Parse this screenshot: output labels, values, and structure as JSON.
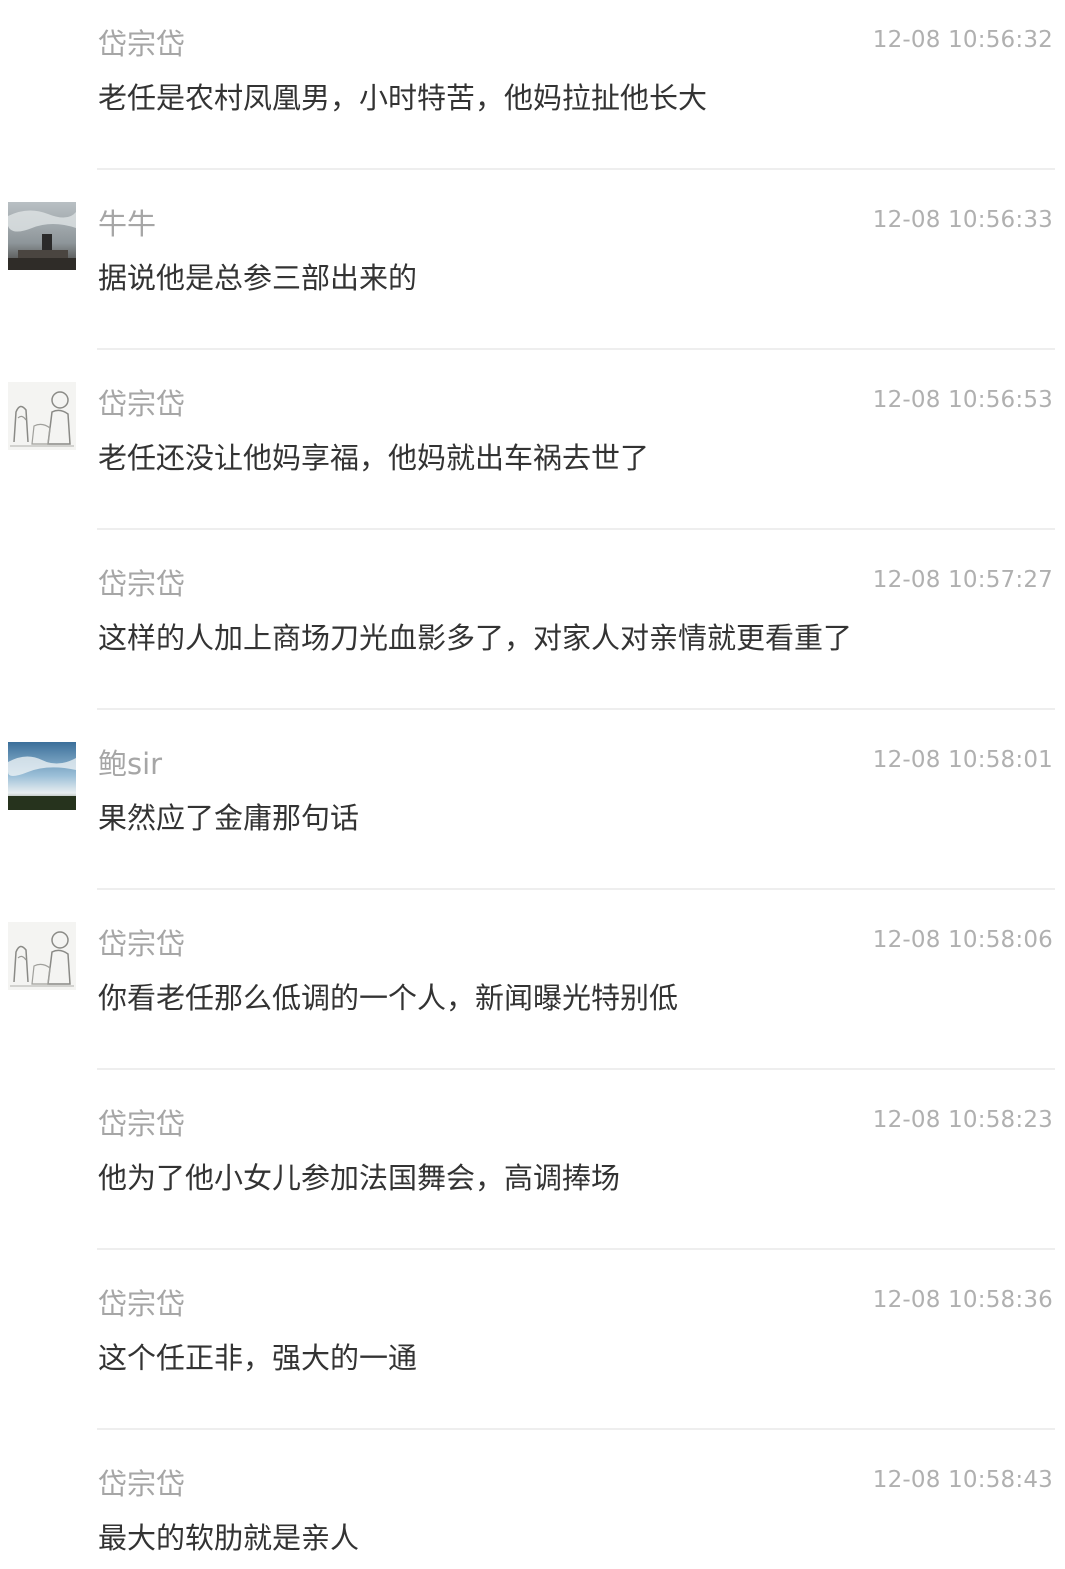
{
  "comments": [
    {
      "author": "岱宗岱",
      "time": "12-08 10:56:32",
      "text": "老任是农村凤凰男，小时特苦，他妈拉扯他长大",
      "avatar": "none"
    },
    {
      "author": "牛牛",
      "time": "12-08 10:56:33",
      "text": "据说他是总参三部出来的",
      "avatar": "photo-avatar"
    },
    {
      "author": "岱宗岱",
      "time": "12-08 10:56:53",
      "text": "老任还没让他妈享福，他妈就出车祸去世了",
      "avatar": "sketch-avatar"
    },
    {
      "author": "岱宗岱",
      "time": "12-08 10:57:27",
      "text": "这样的人加上商场刀光血影多了，对家人对亲情就更看重了",
      "avatar": "none"
    },
    {
      "author": "鲍sir",
      "time": "12-08 10:58:01",
      "text": "果然应了金庸那句话",
      "avatar": "sky-avatar"
    },
    {
      "author": "岱宗岱",
      "time": "12-08 10:58:06",
      "text": "你看老任那么低调的一个人，新闻曝光特别低",
      "avatar": "sketch-avatar"
    },
    {
      "author": "岱宗岱",
      "time": "12-08 10:58:23",
      "text": "他为了他小女儿参加法国舞会，高调捧场",
      "avatar": "none"
    },
    {
      "author": "岱宗岱",
      "time": "12-08 10:58:36",
      "text": "这个任正非，强大的一通",
      "avatar": "none"
    },
    {
      "author": "岱宗岱",
      "time": "12-08 10:58:43",
      "text": "最大的软肋就是亲人",
      "avatar": "none"
    }
  ]
}
